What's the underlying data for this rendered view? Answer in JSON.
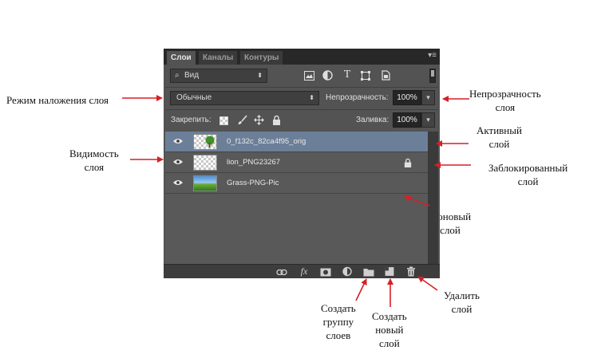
{
  "panel": {
    "tabs": [
      {
        "label": "Слои",
        "active": true
      },
      {
        "label": "Каналы",
        "active": false
      },
      {
        "label": "Контуры",
        "active": false
      }
    ],
    "filter": {
      "label": "Вид"
    },
    "blend_mode": "Обычные",
    "opacity": {
      "label": "Непрозрачность:",
      "value": "100%"
    },
    "lock": {
      "label": "Закрепить:"
    },
    "fill": {
      "label": "Заливка:",
      "value": "100%"
    },
    "layers": [
      {
        "name": "0_f132c_82ca4f95_orig",
        "selected": true,
        "locked": false,
        "thumb": "checker-tree"
      },
      {
        "name": "lion_PNG23267",
        "selected": false,
        "locked": true,
        "thumb": "checker"
      },
      {
        "name": "Grass-PNG-Pic",
        "selected": false,
        "locked": false,
        "thumb": "grass"
      }
    ]
  },
  "annotations": {
    "blend_mode": "Режим наложения слоя",
    "opacity": [
      "Непрозрачность",
      "слоя"
    ],
    "active": [
      "Активный",
      "слой"
    ],
    "visibility": [
      "Видимость",
      "слоя"
    ],
    "locked": [
      "Заблокированный",
      "слой"
    ],
    "background": [
      "Фоновый",
      "слой"
    ],
    "group": [
      "Создать",
      "группу",
      "слоев"
    ],
    "new_layer": [
      "Создать",
      "новый",
      "слой"
    ],
    "delete": [
      "Удалить",
      "слой"
    ]
  },
  "colors": {
    "arrow": "#d81f26",
    "panel": "#535353",
    "selection": "#6c7f99"
  },
  "icons": [
    "eye-icon",
    "lock-icon",
    "link-icon",
    "fx-icon",
    "mask-icon",
    "adjustment-icon",
    "folder-icon",
    "new-layer-icon",
    "trash-icon"
  ]
}
